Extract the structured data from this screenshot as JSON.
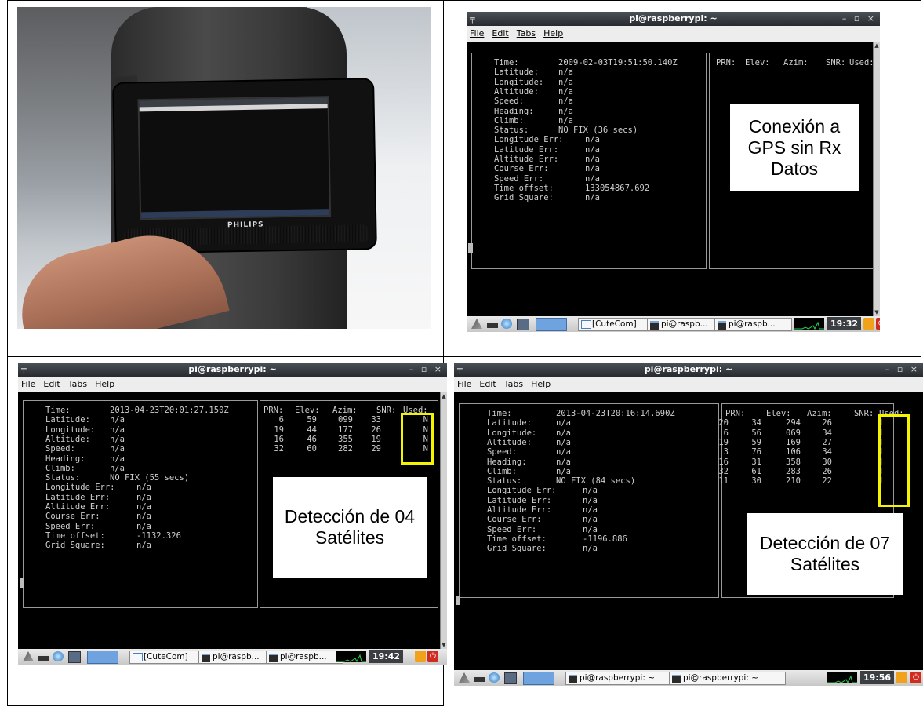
{
  "photo": {
    "brand": "PHILIPS"
  },
  "panel_tr": {
    "title": "pi@raspberrypi: ~",
    "menu": [
      "File",
      "Edit",
      "Tabs",
      "Help"
    ],
    "fields": [
      {
        "label": "Time:",
        "value": "2009-02-03T19:51:50.140Z"
      },
      {
        "label": "Latitude:",
        "value": "n/a"
      },
      {
        "label": "Longitude:",
        "value": "n/a"
      },
      {
        "label": "Altitude:",
        "value": "n/a"
      },
      {
        "label": "Speed:",
        "value": "n/a"
      },
      {
        "label": "Heading:",
        "value": "n/a"
      },
      {
        "label": "Climb:",
        "value": "n/a"
      },
      {
        "label": "Status:",
        "value": "NO FIX (36 secs)"
      },
      {
        "label": "Longitude Err:",
        "value": "n/a"
      },
      {
        "label": "Latitude Err:",
        "value": "n/a"
      },
      {
        "label": "Altitude Err:",
        "value": "n/a"
      },
      {
        "label": "Course Err:",
        "value": "n/a"
      },
      {
        "label": "Speed Err:",
        "value": "n/a"
      },
      {
        "label": "Time offset:",
        "value": "133054867.692"
      },
      {
        "label": "Grid Square:",
        "value": "n/a"
      }
    ],
    "sat_headers": [
      "PRN:",
      "Elev:",
      "Azim:",
      "SNR:",
      "Used:"
    ],
    "satellites": [],
    "callout": "Conexión a GPS sin Rx Datos",
    "taskbar": {
      "btn1": "[CuteCom]",
      "btn2": "pi@raspb...",
      "btn3": "pi@raspb...",
      "clock": "19:32"
    }
  },
  "panel_bl": {
    "title": "pi@raspberrypi: ~",
    "menu": [
      "File",
      "Edit",
      "Tabs",
      "Help"
    ],
    "fields": [
      {
        "label": "Time:",
        "value": "2013-04-23T20:01:27.150Z"
      },
      {
        "label": "Latitude:",
        "value": "n/a"
      },
      {
        "label": "Longitude:",
        "value": "n/a"
      },
      {
        "label": "Altitude:",
        "value": "n/a"
      },
      {
        "label": "Speed:",
        "value": "n/a"
      },
      {
        "label": "Heading:",
        "value": "n/a"
      },
      {
        "label": "Climb:",
        "value": "n/a"
      },
      {
        "label": "Status:",
        "value": "NO FIX (55 secs)"
      },
      {
        "label": "Longitude Err:",
        "value": "n/a"
      },
      {
        "label": "Latitude Err:",
        "value": "n/a"
      },
      {
        "label": "Altitude Err:",
        "value": "n/a"
      },
      {
        "label": "Course Err:",
        "value": "n/a"
      },
      {
        "label": "Speed Err:",
        "value": "n/a"
      },
      {
        "label": "Time offset:",
        "value": "-1132.326"
      },
      {
        "label": "Grid Square:",
        "value": "n/a"
      }
    ],
    "sat_headers": [
      "PRN:",
      "Elev:",
      "Azim:",
      "SNR:",
      "Used:"
    ],
    "satellites": [
      {
        "prn": "6",
        "elev": "59",
        "azim": "099",
        "snr": "33",
        "used": "N"
      },
      {
        "prn": "19",
        "elev": "44",
        "azim": "177",
        "snr": "26",
        "used": "N"
      },
      {
        "prn": "16",
        "elev": "46",
        "azim": "355",
        "snr": "19",
        "used": "N"
      },
      {
        "prn": "32",
        "elev": "60",
        "azim": "282",
        "snr": "29",
        "used": "N"
      }
    ],
    "callout": "Detección de 04 Satélites",
    "taskbar": {
      "btn1": "[CuteCom]",
      "btn2": "pi@raspb...",
      "btn3": "pi@raspb...",
      "clock": "19:42"
    }
  },
  "panel_br": {
    "title": "pi@raspberrypi: ~",
    "menu": [
      "File",
      "Edit",
      "Tabs",
      "Help"
    ],
    "fields": [
      {
        "label": "Time:",
        "value": "2013-04-23T20:16:14.690Z"
      },
      {
        "label": "Latitude:",
        "value": "n/a"
      },
      {
        "label": "Longitude:",
        "value": "n/a"
      },
      {
        "label": "Altitude:",
        "value": "n/a"
      },
      {
        "label": "Speed:",
        "value": "n/a"
      },
      {
        "label": "Heading:",
        "value": "n/a"
      },
      {
        "label": "Climb:",
        "value": "n/a"
      },
      {
        "label": "Status:",
        "value": "NO FIX (84 secs)"
      },
      {
        "label": "Longitude Err:",
        "value": "n/a"
      },
      {
        "label": "Latitude Err:",
        "value": "n/a"
      },
      {
        "label": "Altitude Err:",
        "value": "n/a"
      },
      {
        "label": "Course Err:",
        "value": "n/a"
      },
      {
        "label": "Speed Err:",
        "value": "n/a"
      },
      {
        "label": "Time offset:",
        "value": "-1196.886"
      },
      {
        "label": "Grid Square:",
        "value": "n/a"
      }
    ],
    "sat_headers": [
      "PRN:",
      "Elev:",
      "Azim:",
      "SNR:",
      "Used:"
    ],
    "satellites": [
      {
        "prn": "20",
        "elev": "34",
        "azim": "294",
        "snr": "26",
        "used": "N"
      },
      {
        "prn": "6",
        "elev": "56",
        "azim": "069",
        "snr": "34",
        "used": "N"
      },
      {
        "prn": "19",
        "elev": "59",
        "azim": "169",
        "snr": "27",
        "used": "N"
      },
      {
        "prn": "3",
        "elev": "76",
        "azim": "106",
        "snr": "34",
        "used": "N"
      },
      {
        "prn": "16",
        "elev": "31",
        "azim": "358",
        "snr": "30",
        "used": "N"
      },
      {
        "prn": "32",
        "elev": "61",
        "azim": "283",
        "snr": "26",
        "used": "N"
      },
      {
        "prn": "11",
        "elev": "30",
        "azim": "210",
        "snr": "22",
        "used": "N"
      }
    ],
    "callout": "Detección de 07 Satélites",
    "taskbar": {
      "btn1": "pi@raspberrypi: ~",
      "btn2": "pi@raspberrypi: ~",
      "clock": "19:56"
    }
  }
}
